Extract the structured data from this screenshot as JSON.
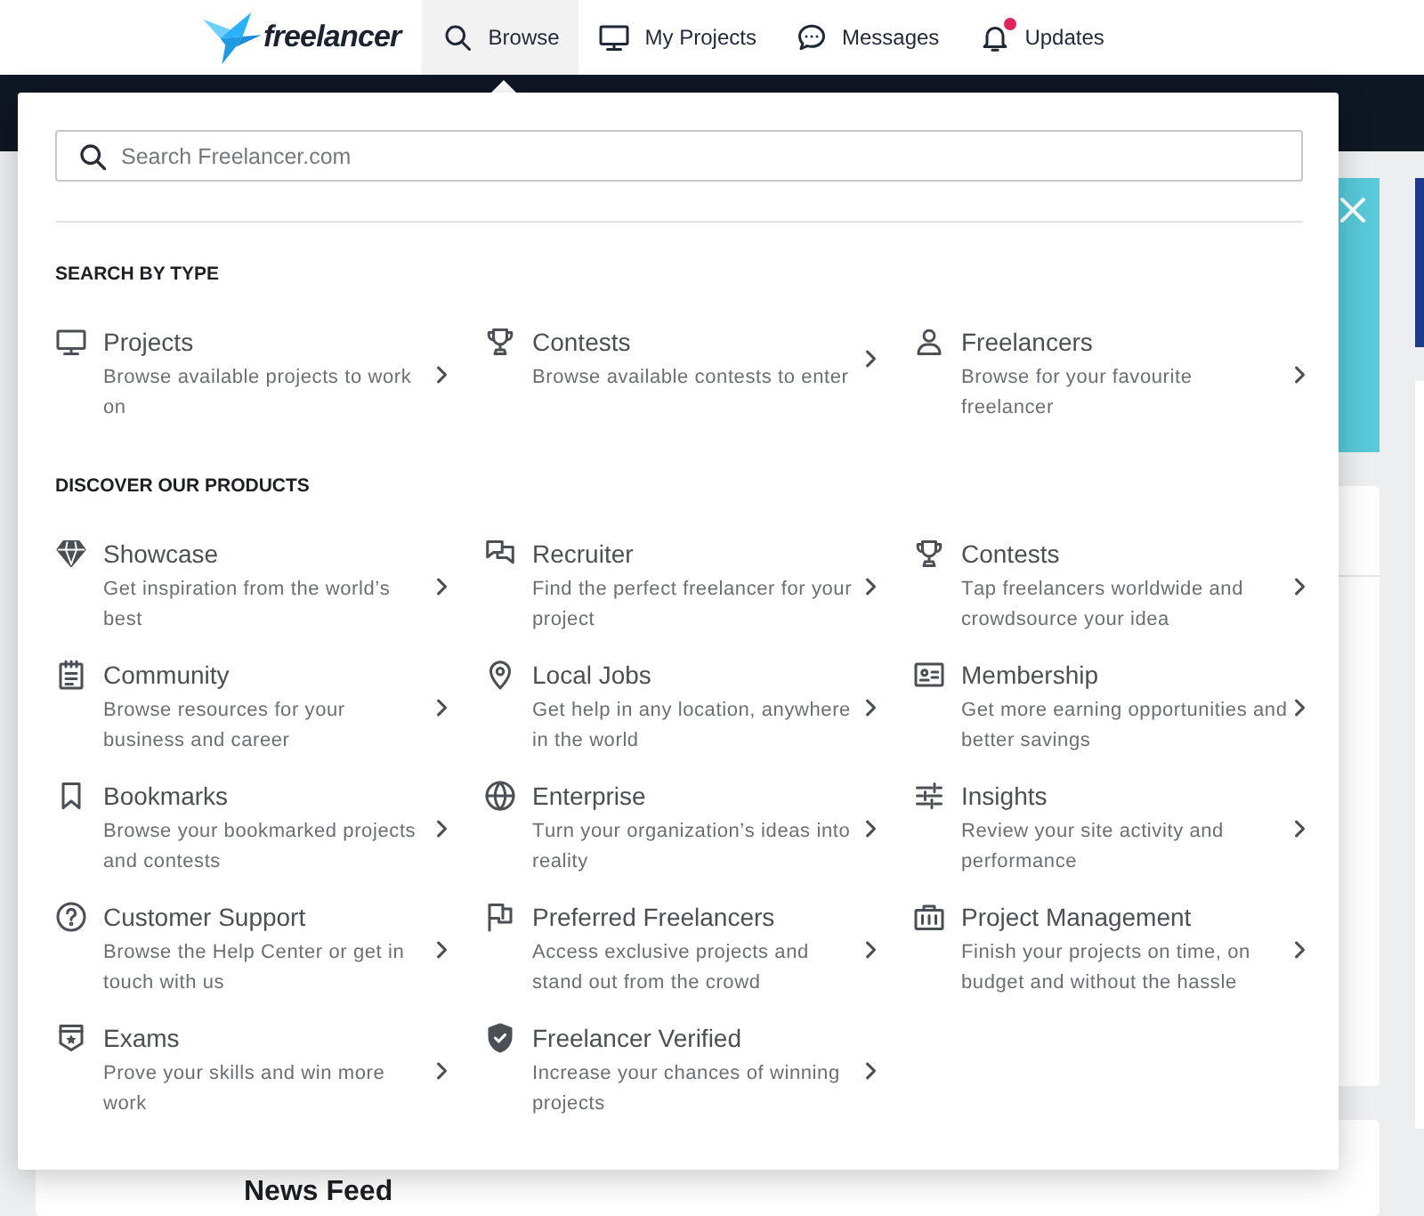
{
  "nav": {
    "logo_text": "freelancer",
    "items": [
      {
        "label": "Browse",
        "selected": true,
        "notification": false
      },
      {
        "label": "My Projects",
        "selected": false,
        "notification": false
      },
      {
        "label": "Messages",
        "selected": false,
        "notification": false
      },
      {
        "label": "Updates",
        "selected": false,
        "notification": true
      }
    ]
  },
  "browse_menu": {
    "search": {
      "placeholder": "Search Freelancer.com"
    },
    "sections": [
      {
        "heading": "SEARCH BY TYPE",
        "items": [
          {
            "title": "Projects",
            "description": "Browse available projects to work on"
          },
          {
            "title": "Contests",
            "description": "Browse available contests to enter"
          },
          {
            "title": "Freelancers",
            "description": "Browse for your favourite freelancer"
          }
        ]
      },
      {
        "heading": "DISCOVER OUR PRODUCTS",
        "items": [
          {
            "title": "Showcase",
            "description": "Get inspiration from the world’s best"
          },
          {
            "title": "Recruiter",
            "description": "Find the perfect freelancer for your project"
          },
          {
            "title": "Contests",
            "description": "Tap freelancers worldwide and crowdsource your idea"
          },
          {
            "title": "Community",
            "description": "Browse resources for your business and career"
          },
          {
            "title": "Local Jobs",
            "description": "Get help in any location, anywhere in the world"
          },
          {
            "title": "Membership",
            "description": "Get more earning opportunities and better savings"
          },
          {
            "title": "Bookmarks",
            "description": "Browse your bookmarked projects and contests"
          },
          {
            "title": "Enterprise",
            "description": "Turn your organization’s ideas into reality"
          },
          {
            "title": "Insights",
            "description": "Review your site activity and performance"
          },
          {
            "title": "Customer Support",
            "description": "Browse the Help Center or get in touch with us"
          },
          {
            "title": "Preferred Freelancers",
            "description": "Access exclusive projects and stand out from the crowd"
          },
          {
            "title": "Project Management",
            "description": "Finish your projects on time, on budget and without the hassle"
          },
          {
            "title": "Exams",
            "description": "Prove your skills and win more work"
          },
          {
            "title": "Freelancer Verified",
            "description": "Increase your chances of winning projects"
          }
        ]
      }
    ]
  },
  "feed": {
    "heading": "News Feed"
  }
}
